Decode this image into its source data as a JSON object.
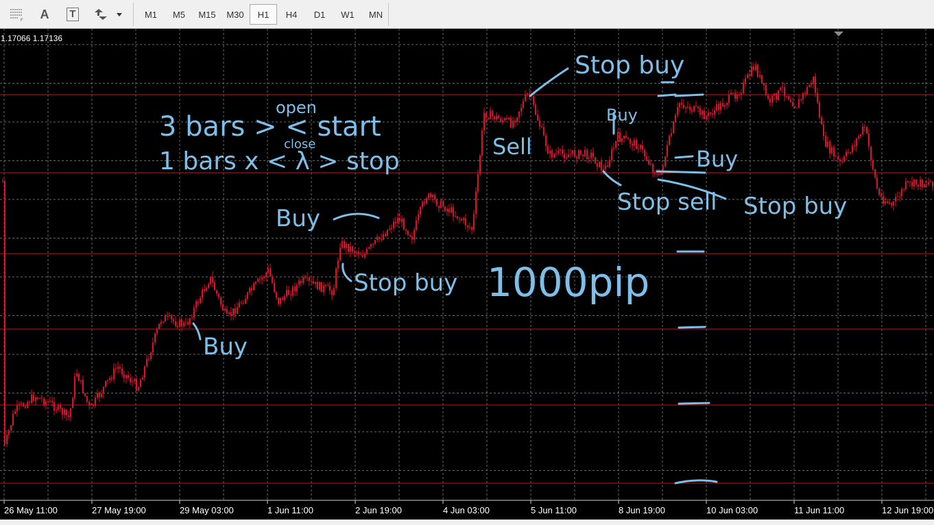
{
  "toolbar": {
    "tools": [
      {
        "name": "period-separators",
        "icon": "grid-icon"
      },
      {
        "name": "text",
        "label": "A",
        "icon": "text-icon"
      },
      {
        "name": "text-label",
        "label": "T",
        "icon": "text-label-icon"
      },
      {
        "name": "arrows",
        "icon": "arrows-icon"
      }
    ],
    "timeframes": [
      "M1",
      "M5",
      "M15",
      "M30",
      "H1",
      "H4",
      "D1",
      "W1",
      "MN"
    ],
    "active_timeframe": "H1"
  },
  "chart": {
    "price_readout": "1.17066 1.17136",
    "background": "#000000",
    "candle_color": "#e0102a",
    "level_line_color": "#cc1111",
    "annotation_color": "#7dbfe9",
    "time_labels": [
      "26 May 11:00",
      "27 May 19:00",
      "29 May 03:00",
      "1 Jun 11:00",
      "2 Jun 19:00",
      "4 Jun 03:00",
      "5 Jun 11:00",
      "8 Jun 19:00",
      "10 Jun 03:00",
      "11 Jun 11:00",
      "12 Jun 19:00"
    ]
  },
  "annotations": {
    "rule_open": "open",
    "rule_close": "close",
    "rule_line1": "3 bars > < start",
    "rule_line2": "1 bars x < λ > stop",
    "stop_buy_top": "Stop buy",
    "sell": "Sell",
    "buy_small": "Buy",
    "buy_right": "Buy",
    "stop_sell": "Stop sell",
    "stop_buy_right": "Stop buy",
    "buy_mid": "Buy",
    "stop_buy_mid": "Stop buy",
    "pip_label": "1000pip",
    "buy_low": "Buy"
  }
}
